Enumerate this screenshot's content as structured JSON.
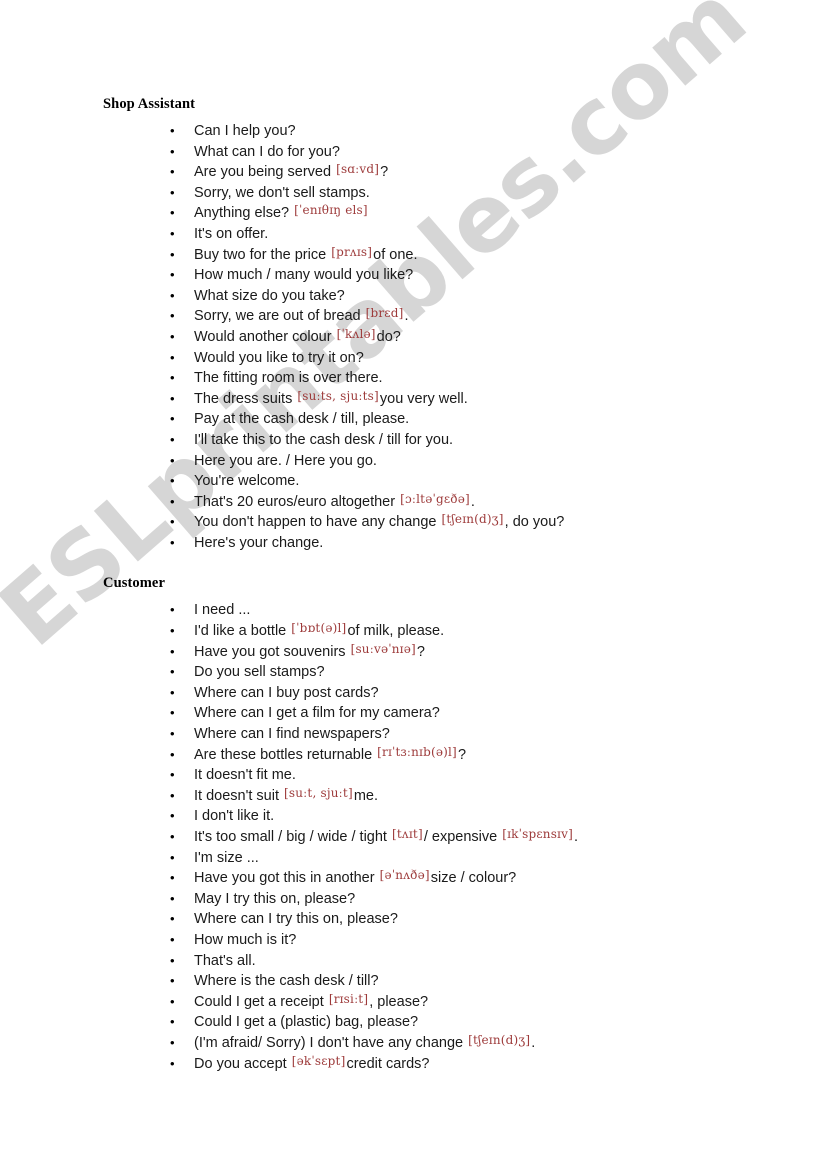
{
  "document": {
    "watermark_text": "ESLprintables.com",
    "bullet_glyph": "•"
  },
  "sections": [
    {
      "title": "Shop Assistant",
      "items": [
        [
          {
            "t": "text",
            "v": "Can I help you?"
          }
        ],
        [
          {
            "t": "text",
            "v": "What can I do for you?"
          }
        ],
        [
          {
            "t": "text",
            "v": "Are you being served "
          },
          {
            "t": "ipa",
            "v": "[sɑːvd]"
          },
          {
            "t": "text",
            "v": "?"
          }
        ],
        [
          {
            "t": "text",
            "v": "Sorry, we don't sell stamps."
          }
        ],
        [
          {
            "t": "text",
            "v": "Anything else? "
          },
          {
            "t": "ipa",
            "v": "[ˈenɪθɪŋ els]"
          }
        ],
        [
          {
            "t": "text",
            "v": "It's on offer."
          }
        ],
        [
          {
            "t": "text",
            "v": "Buy two for the price "
          },
          {
            "t": "ipa",
            "v": "[prʌɪs]"
          },
          {
            "t": "text",
            "v": "of one."
          }
        ],
        [
          {
            "t": "text",
            "v": "How much / many would you like?"
          }
        ],
        [
          {
            "t": "text",
            "v": "What size do you take?"
          }
        ],
        [
          {
            "t": "text",
            "v": "Sorry, we are out of bread "
          },
          {
            "t": "ipa",
            "v": "[brɛd]"
          },
          {
            "t": "text",
            "v": "."
          }
        ],
        [
          {
            "t": "text",
            "v": "Would another colour "
          },
          {
            "t": "ipa",
            "v": "[ˈkʌlə]"
          },
          {
            "t": "text",
            "v": "do?"
          }
        ],
        [
          {
            "t": "text",
            "v": "Would you like to try it on?"
          }
        ],
        [
          {
            "t": "text",
            "v": "The fitting room is over there."
          }
        ],
        [
          {
            "t": "text",
            "v": "The dress suits "
          },
          {
            "t": "ipa",
            "v": "[suːts, sjuːts]"
          },
          {
            "t": "text",
            "v": "you very well."
          }
        ],
        [
          {
            "t": "text",
            "v": "Pay at the cash desk / till, please."
          }
        ],
        [
          {
            "t": "text",
            "v": "I'll take this to the cash desk / till for you."
          }
        ],
        [
          {
            "t": "text",
            "v": "Here you are. / Here you go."
          }
        ],
        [
          {
            "t": "text",
            "v": "You're welcome."
          }
        ],
        [
          {
            "t": "text",
            "v": "That's 20 euros/euro altogether "
          },
          {
            "t": "ipa",
            "v": "[ɔːltəˈgɛðə]"
          },
          {
            "t": "text",
            "v": "."
          }
        ],
        [
          {
            "t": "text",
            "v": "You don't happen to have any change "
          },
          {
            "t": "ipa",
            "v": "[tʃeɪn(d)ʒ]"
          },
          {
            "t": "text",
            "v": ", do you?"
          }
        ],
        [
          {
            "t": "text",
            "v": "Here's your change."
          }
        ]
      ]
    },
    {
      "title": "Customer",
      "items": [
        [
          {
            "t": "text",
            "v": "I need ..."
          }
        ],
        [
          {
            "t": "text",
            "v": "I'd like a bottle "
          },
          {
            "t": "ipa",
            "v": "[ˈbɒt(ə)l]"
          },
          {
            "t": "text",
            "v": "of milk, please."
          }
        ],
        [
          {
            "t": "text",
            "v": "Have you got souvenirs "
          },
          {
            "t": "ipa",
            "v": "[suːvəˈnɪə]"
          },
          {
            "t": "text",
            "v": "?"
          }
        ],
        [
          {
            "t": "text",
            "v": "Do you sell stamps?"
          }
        ],
        [
          {
            "t": "text",
            "v": "Where can I buy post cards?"
          }
        ],
        [
          {
            "t": "text",
            "v": "Where can I get a film for my camera?"
          }
        ],
        [
          {
            "t": "text",
            "v": "Where can I find newspapers?"
          }
        ],
        [
          {
            "t": "text",
            "v": "Are these bottles returnable "
          },
          {
            "t": "ipa",
            "v": "[rɪˈtɜːnɪb(ə)l]"
          },
          {
            "t": "text",
            "v": "?"
          }
        ],
        [
          {
            "t": "text",
            "v": "It doesn't fit me."
          }
        ],
        [
          {
            "t": "text",
            "v": "It doesn't suit "
          },
          {
            "t": "ipa",
            "v": "[suːt, sjuːt]"
          },
          {
            "t": "text",
            "v": "me."
          }
        ],
        [
          {
            "t": "text",
            "v": "I don't like it."
          }
        ],
        [
          {
            "t": "text",
            "v": "It's too small / big / wide / tight "
          },
          {
            "t": "ipa",
            "v": "[tʌɪt]"
          },
          {
            "t": "text",
            "v": "/ expensive "
          },
          {
            "t": "ipa",
            "v": "[ɪkˈspɛnsɪv]"
          },
          {
            "t": "text",
            "v": "."
          }
        ],
        [
          {
            "t": "text",
            "v": "I'm size ..."
          }
        ],
        [
          {
            "t": "text",
            "v": "Have you got this in another "
          },
          {
            "t": "ipa",
            "v": "[əˈnʌðə]"
          },
          {
            "t": "text",
            "v": "size / colour?"
          }
        ],
        [
          {
            "t": "text",
            "v": "May I try this on, please?"
          }
        ],
        [
          {
            "t": "text",
            "v": "Where can I try this on, please?"
          }
        ],
        [
          {
            "t": "text",
            "v": "How much is it?"
          }
        ],
        [
          {
            "t": "text",
            "v": "That's all."
          }
        ],
        [
          {
            "t": "text",
            "v": "Where is the cash desk / till?"
          }
        ],
        [
          {
            "t": "text",
            "v": "Could I get a receipt "
          },
          {
            "t": "ipa",
            "v": "[rɪsiːt]"
          },
          {
            "t": "text",
            "v": ", please?"
          }
        ],
        [
          {
            "t": "text",
            "v": "Could I get a (plastic) bag, please?"
          }
        ],
        [
          {
            "t": "text",
            "v": "(I'm afraid/ Sorry) I don't have any change "
          },
          {
            "t": "ipa",
            "v": "[tʃeɪn(d)ʒ]"
          },
          {
            "t": "text",
            "v": "."
          }
        ],
        [
          {
            "t": "text",
            "v": "Do you accept "
          },
          {
            "t": "ipa",
            "v": "[əkˈsɛpt]"
          },
          {
            "t": "text",
            "v": "credit cards?"
          }
        ]
      ]
    }
  ]
}
